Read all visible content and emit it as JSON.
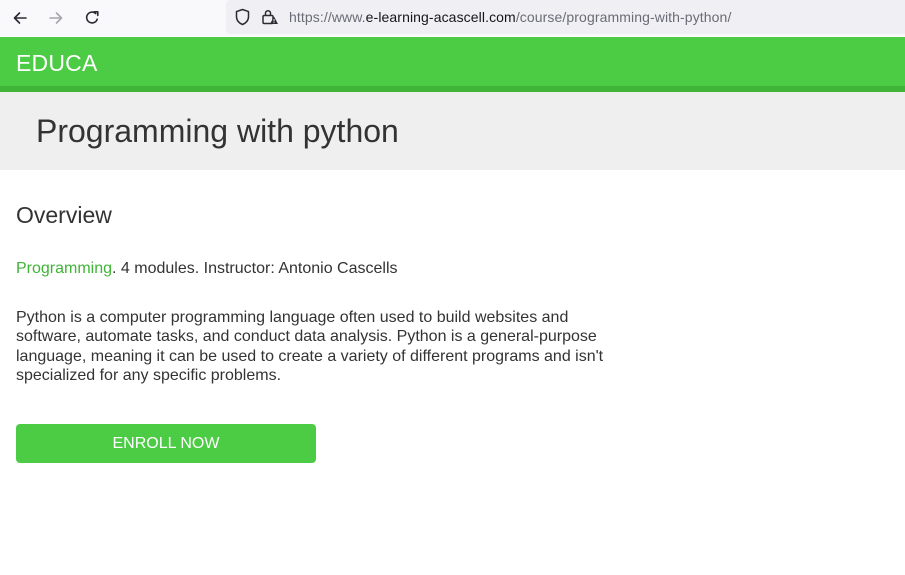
{
  "browser": {
    "url_prefix": "https://www.",
    "url_domain": "e-learning-acascell.com",
    "url_path": "/course/programming-with-python/"
  },
  "site": {
    "logo": "EDUCA",
    "brand_color": "#4ccc44",
    "accent_dark": "#3fb437"
  },
  "course": {
    "title": "Programming with python",
    "overview_heading": "Overview",
    "category": "Programming",
    "meta": ". 4 modules. Instructor: Antonio Cascells",
    "description": "Python is a computer programming language often used to build websites and software, automate tasks, and conduct data analysis. Python is a general-purpose language, meaning it can be used to create a variety of different programs and isn't specialized for any specific problems.",
    "enroll_label": "ENROLL NOW"
  },
  "icons": {
    "back": "arrow-left",
    "forward": "arrow-right",
    "reload": "reload",
    "tracking_protection": "shield",
    "connection": "lock-warning"
  }
}
